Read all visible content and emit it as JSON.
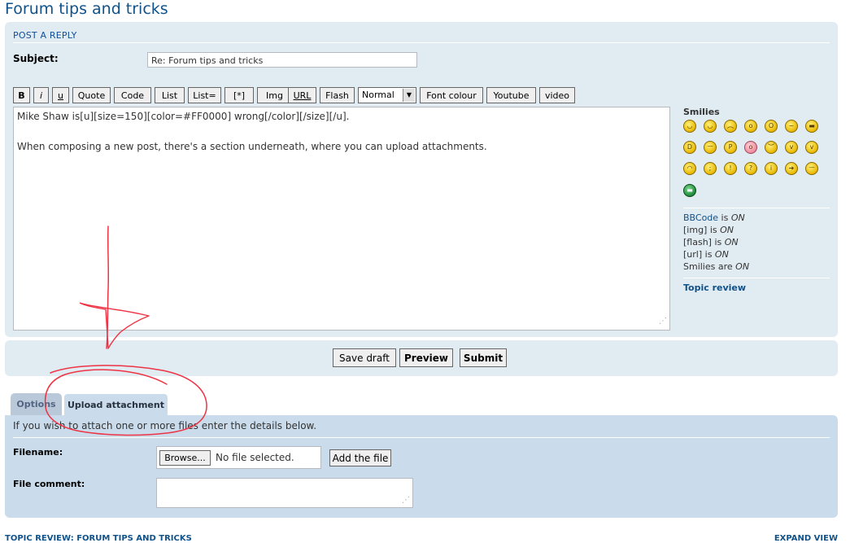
{
  "page": {
    "title": "Forum tips and tricks"
  },
  "post_reply": {
    "heading": "POST A REPLY",
    "subject_label": "Subject:",
    "subject_value": "Re: Forum tips and tricks"
  },
  "toolbar": {
    "bold": "B",
    "italic": "i",
    "underline": "u",
    "quote": "Quote",
    "code": "Code",
    "list": "List",
    "list_eq": "List=",
    "list_item": "[*]",
    "img": "Img",
    "url": "URL",
    "flash": "Flash",
    "size_value": "Normal",
    "font_colour": "Font colour",
    "youtube": "Youtube",
    "video": "video"
  },
  "editor": {
    "line1": "Mike Shaw is[u][size=150][color=#FF0000] wrong[/color][/size][/u].",
    "line2": "When composing a new post, there's a section underneath, where you can upload attachments."
  },
  "sidebar": {
    "smilies_title": "Smilies",
    "bbcode_link": "BBCode",
    "bbcode_is": " is ",
    "bbcode_state": "ON",
    "img_tag": "[img]",
    "img_is": " is ",
    "img_state": "ON",
    "flash_tag": "[flash]",
    "flash_is": " is ",
    "flash_state": "ON",
    "url_tag": "[url]",
    "url_is": " is ",
    "url_state": "ON",
    "smilies_are": "Smilies are ",
    "smilies_state": "ON",
    "topic_review": "Topic review"
  },
  "submit_bar": {
    "save_draft": "Save draft",
    "preview": "Preview",
    "submit": "Submit"
  },
  "tabs": {
    "options": "Options",
    "upload": "Upload attachment"
  },
  "upload": {
    "intro": "If you wish to attach one or more files enter the details below.",
    "filename_label": "Filename:",
    "browse": "Browse...",
    "no_file": "No file selected.",
    "add_file": "Add the file",
    "comment_label": "File comment:"
  },
  "footer": {
    "topic_review": "TOPIC REVIEW: FORUM TIPS AND TRICKS",
    "expand_view": "EXPAND VIEW"
  },
  "colors": {
    "link": "#105289",
    "panel": "#e1ebf2",
    "upload_panel": "#cadceb",
    "annotation": "#ee3344"
  }
}
